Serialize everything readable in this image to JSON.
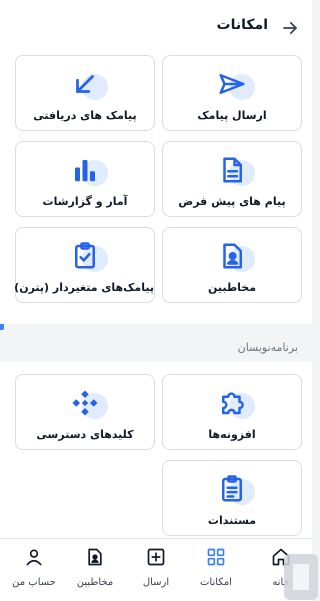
{
  "header": {
    "title": "امکانات"
  },
  "features": [
    {
      "label": "ارسال پیامک",
      "icon": "send-icon"
    },
    {
      "label": "پیامک های دریافتی",
      "icon": "arrow-down-left-icon"
    },
    {
      "label": "پیام های پیش فرض",
      "icon": "document-icon"
    },
    {
      "label": "آمار و گزارشات",
      "icon": "bar-chart-icon"
    },
    {
      "label": "مخاطبین",
      "icon": "contact-icon"
    },
    {
      "label": "پیامک‌های متغیردار (پترن)",
      "icon": "clipboard-check-icon"
    }
  ],
  "developer": {
    "heading": "برنامه‌نویسان",
    "items": [
      {
        "label": "افزونه‌ها",
        "icon": "puzzle-icon"
      },
      {
        "label": "کلیدهای دسترسی",
        "icon": "api-keys-icon"
      },
      {
        "label": "مستندات",
        "icon": "docs-icon"
      }
    ]
  },
  "bottom_nav": [
    {
      "label": "خانه",
      "icon": "home-icon",
      "active": false
    },
    {
      "label": "امکانات",
      "icon": "grid-icon",
      "active": true
    },
    {
      "label": "ارسال",
      "icon": "plus-square-icon",
      "active": false
    },
    {
      "label": "مخاطبین",
      "icon": "contact-icon",
      "active": false
    },
    {
      "label": "حساب من",
      "icon": "user-icon",
      "active": false
    }
  ],
  "colors": {
    "accent": "#3b82f6",
    "bubble": "#e0ebfb",
    "background": "#f3f4f6"
  }
}
